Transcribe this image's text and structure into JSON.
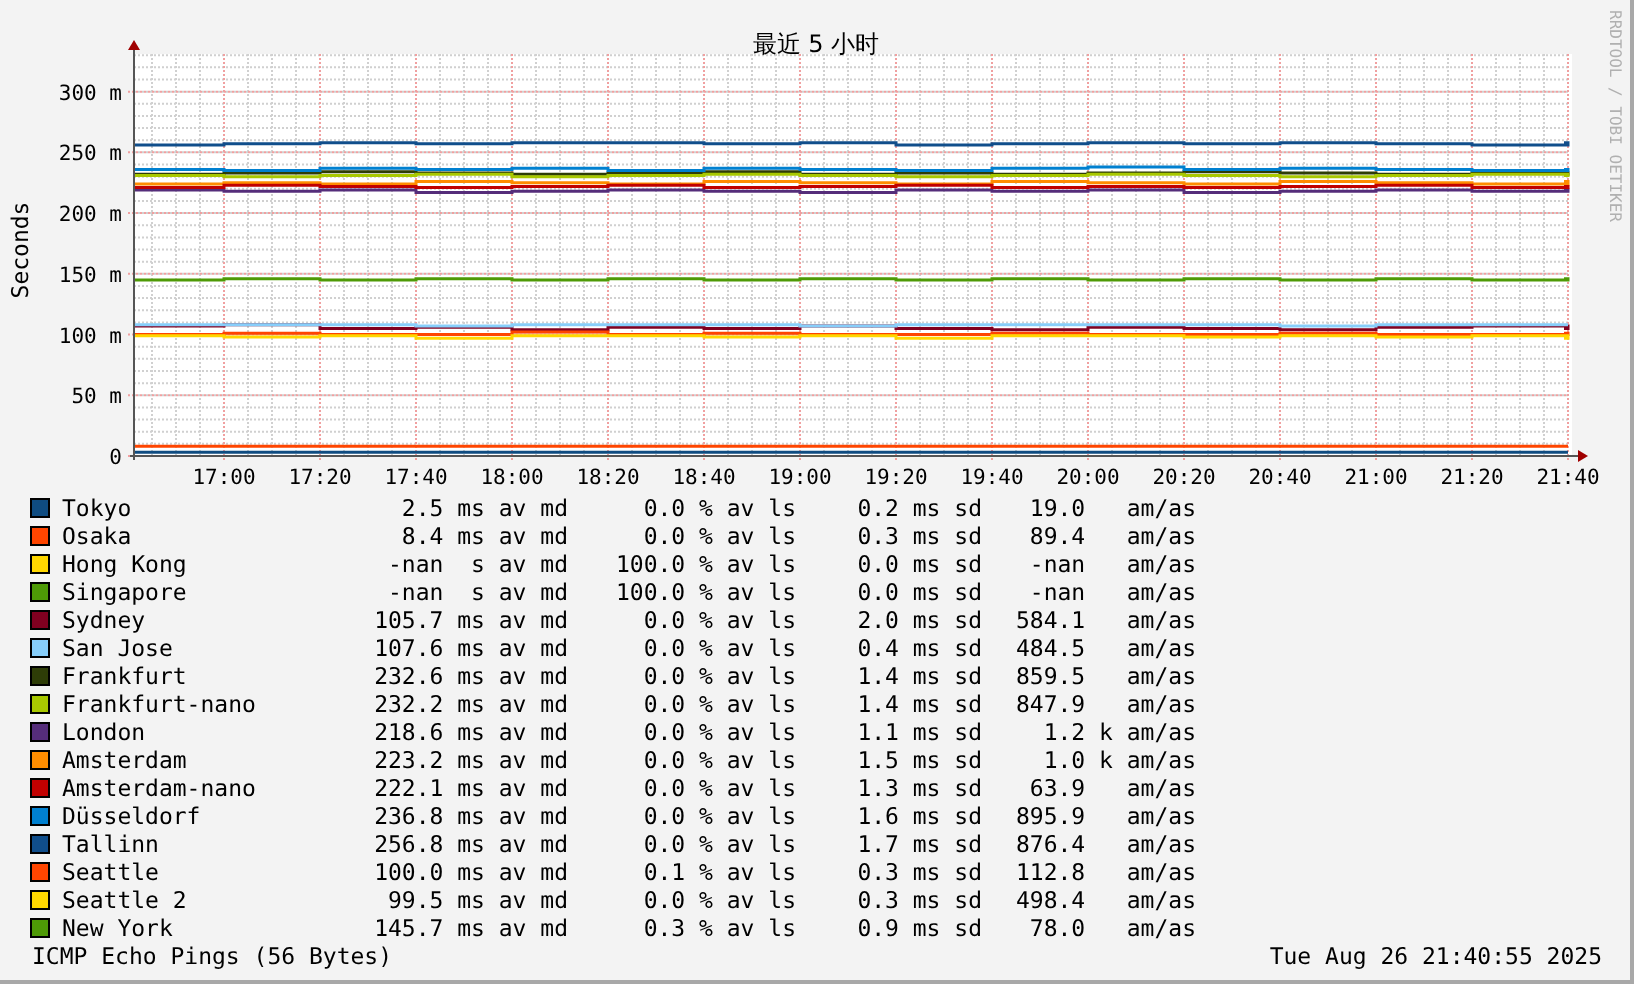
{
  "chart": {
    "credit": "RRDTOOL / TOBI OETIKER",
    "chart_data": {
      "type": "line",
      "title": "最近 5 小时",
      "ylabel": "Seconds",
      "ylim": [
        0,
        331
      ],
      "grid": true,
      "categories": [
        null,
        "17:00",
        "17:20",
        "17:40",
        "18:00",
        "18:20",
        "18:40",
        "19:00",
        "19:20",
        "19:40",
        "20:00",
        "20:20",
        "20:40",
        "21:00",
        "21:20",
        "21:40"
      ],
      "yticks": [
        {
          "value": 0,
          "label": "0"
        },
        {
          "value": 50,
          "label": "50 m"
        },
        {
          "value": 100,
          "label": "100 m"
        },
        {
          "value": 150,
          "label": "150 m"
        },
        {
          "value": 200,
          "label": "200 m"
        },
        {
          "value": 250,
          "label": "250 m"
        },
        {
          "value": 300,
          "label": "300 m"
        }
      ],
      "series": [
        {
          "name": "Tokyo",
          "color": "#0f4c81",
          "values": [
            3,
            3,
            3,
            3,
            3,
            3,
            3,
            3,
            3,
            3,
            3,
            3,
            3,
            3,
            3,
            3
          ]
        },
        {
          "name": "Osaka",
          "color": "#ff4500",
          "values": [
            8,
            8,
            8,
            8,
            8,
            8,
            8,
            8,
            8,
            8,
            8,
            8,
            8,
            8,
            8,
            8
          ]
        },
        {
          "name": "Hong Kong",
          "color": "#ffd700",
          "values": [
            null,
            null,
            null,
            null,
            null,
            null,
            null,
            null,
            null,
            null,
            null,
            null,
            null,
            null,
            null,
            null
          ]
        },
        {
          "name": "Singapore",
          "color": "#4e9a06",
          "values": [
            null,
            null,
            null,
            null,
            null,
            null,
            null,
            null,
            null,
            null,
            null,
            null,
            null,
            null,
            null,
            null
          ]
        },
        {
          "name": "Sydney",
          "color": "#800020",
          "values": [
            107,
            108,
            105,
            106,
            104,
            106,
            105,
            107,
            105,
            104,
            106,
            105,
            104,
            106,
            107,
            105
          ]
        },
        {
          "name": "San Jose",
          "color": "#87cefa",
          "values": [
            108,
            108,
            108,
            107,
            108,
            108,
            108,
            107,
            108,
            108,
            108,
            108,
            107,
            108,
            108,
            108
          ]
        },
        {
          "name": "Frankfurt",
          "color": "#2e3d07",
          "values": [
            232,
            233,
            234,
            233,
            232,
            233,
            234,
            232,
            233,
            232,
            233,
            234,
            233,
            232,
            233,
            232
          ]
        },
        {
          "name": "Frankfurt-nano",
          "color": "#a8c800",
          "values": [
            231,
            230,
            231,
            232,
            230,
            231,
            232,
            231,
            230,
            231,
            232,
            231,
            230,
            231,
            232,
            231
          ]
        },
        {
          "name": "London",
          "color": "#552d7a",
          "values": [
            219,
            218,
            219,
            217,
            218,
            219,
            218,
            217,
            219,
            218,
            219,
            217,
            218,
            219,
            218,
            219
          ]
        },
        {
          "name": "Amsterdam",
          "color": "#ff8c00",
          "values": [
            224,
            225,
            224,
            226,
            225,
            224,
            226,
            225,
            224,
            226,
            225,
            224,
            226,
            225,
            224,
            226
          ]
        },
        {
          "name": "Amsterdam-nano",
          "color": "#c00000",
          "values": [
            221,
            223,
            222,
            221,
            222,
            223,
            221,
            222,
            223,
            221,
            222,
            221,
            222,
            223,
            221,
            222
          ]
        },
        {
          "name": "Düsseldorf",
          "color": "#0080d0",
          "values": [
            236,
            235,
            237,
            236,
            237,
            235,
            237,
            236,
            235,
            237,
            238,
            236,
            237,
            236,
            235,
            236
          ]
        },
        {
          "name": "Tallinn",
          "color": "#104e8b",
          "values": [
            256,
            257,
            258,
            257,
            258,
            258,
            257,
            258,
            256,
            257,
            258,
            257,
            258,
            257,
            256,
            258
          ]
        },
        {
          "name": "Seattle",
          "color": "#ff4500",
          "values": [
            100,
            101,
            100,
            100,
            102,
            100,
            101,
            100,
            100,
            101,
            100,
            100,
            101,
            100,
            100,
            101
          ]
        },
        {
          "name": "Seattle 2",
          "color": "#ffd700",
          "values": [
            99,
            98,
            99,
            97,
            99,
            99,
            98,
            99,
            97,
            99,
            99,
            98,
            99,
            98,
            99,
            97
          ]
        },
        {
          "name": "New York",
          "color": "#4e9a06",
          "values": [
            145,
            146,
            145,
            146,
            145,
            146,
            145,
            146,
            145,
            146,
            145,
            146,
            145,
            146,
            145,
            146
          ]
        }
      ]
    }
  },
  "legend": [
    {
      "median": "2.5 ms av md",
      "loss": "0.0 % av ls",
      "sd": "0.2 ms sd",
      "ratio": "19.0   am/as"
    },
    {
      "median": "8.4 ms av md",
      "loss": "0.0 % av ls",
      "sd": "0.3 ms sd",
      "ratio": "89.4   am/as"
    },
    {
      "median": "-nan  s av md",
      "loss": "100.0 % av ls",
      "sd": "0.0 ms sd",
      "ratio": "-nan   am/as"
    },
    {
      "median": "-nan  s av md",
      "loss": "100.0 % av ls",
      "sd": "0.0 ms sd",
      "ratio": "-nan   am/as"
    },
    {
      "median": "105.7 ms av md",
      "loss": "0.0 % av ls",
      "sd": "2.0 ms sd",
      "ratio": "584.1   am/as"
    },
    {
      "median": "107.6 ms av md",
      "loss": "0.0 % av ls",
      "sd": "0.4 ms sd",
      "ratio": "484.5   am/as"
    },
    {
      "median": "232.6 ms av md",
      "loss": "0.0 % av ls",
      "sd": "1.4 ms sd",
      "ratio": "859.5   am/as"
    },
    {
      "median": "232.2 ms av md",
      "loss": "0.0 % av ls",
      "sd": "1.4 ms sd",
      "ratio": "847.9   am/as"
    },
    {
      "median": "218.6 ms av md",
      "loss": "0.0 % av ls",
      "sd": "1.1 ms sd",
      "ratio": "1.2 k am/as"
    },
    {
      "median": "223.2 ms av md",
      "loss": "0.0 % av ls",
      "sd": "1.5 ms sd",
      "ratio": "1.0 k am/as"
    },
    {
      "median": "222.1 ms av md",
      "loss": "0.0 % av ls",
      "sd": "1.3 ms sd",
      "ratio": "63.9   am/as"
    },
    {
      "median": "236.8 ms av md",
      "loss": "0.0 % av ls",
      "sd": "1.6 ms sd",
      "ratio": "895.9   am/as"
    },
    {
      "median": "256.8 ms av md",
      "loss": "0.0 % av ls",
      "sd": "1.7 ms sd",
      "ratio": "876.4   am/as"
    },
    {
      "median": "100.0 ms av md",
      "loss": "0.1 % av ls",
      "sd": "0.3 ms sd",
      "ratio": "112.8   am/as"
    },
    {
      "median": "99.5 ms av md",
      "loss": "0.0 % av ls",
      "sd": "0.3 ms sd",
      "ratio": "498.4   am/as"
    },
    {
      "median": "145.7 ms av md",
      "loss": "0.3 % av ls",
      "sd": "0.9 ms sd",
      "ratio": "78.0   am/as"
    }
  ],
  "footer": {
    "probe": "ICMP Echo Pings (56 Bytes)",
    "timestamp": "Tue Aug 26 21:40:55 2025"
  }
}
